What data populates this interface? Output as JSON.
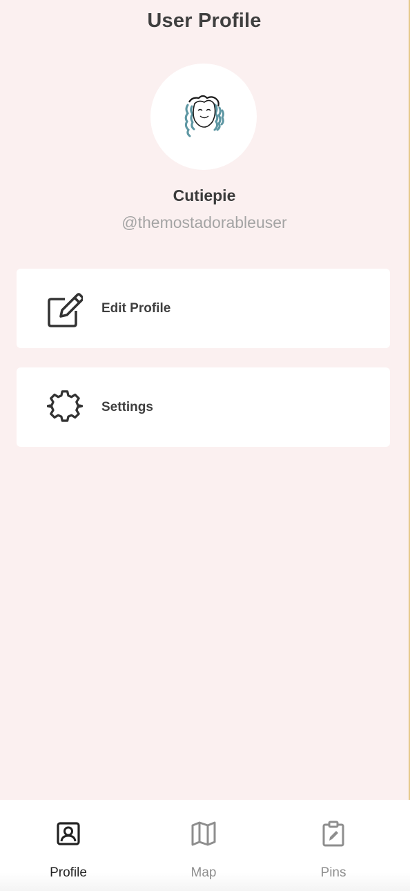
{
  "header": {
    "title": "User Profile"
  },
  "profile": {
    "avatar_icon": "doodle-avatar-icon",
    "display_name": "Cutiepie",
    "username": "@themostadorableuser"
  },
  "menu": [
    {
      "label": "Edit Profile",
      "icon": "edit-icon"
    },
    {
      "label": "Settings",
      "icon": "gear-icon"
    }
  ],
  "tabs": [
    {
      "label": "Profile",
      "icon": "profile-icon",
      "active": true
    },
    {
      "label": "Map",
      "icon": "map-icon",
      "active": false
    },
    {
      "label": "Pins",
      "icon": "clipboard-edit-icon",
      "active": false
    }
  ],
  "colors": {
    "background": "#fbf0f0",
    "card": "#ffffff",
    "text_dark": "#3f3f3f",
    "text_muted": "#a4a4a4",
    "tab_active": "#222222",
    "tab_inactive": "#8e8e8e",
    "avatar_hair": "#5e97a3"
  }
}
